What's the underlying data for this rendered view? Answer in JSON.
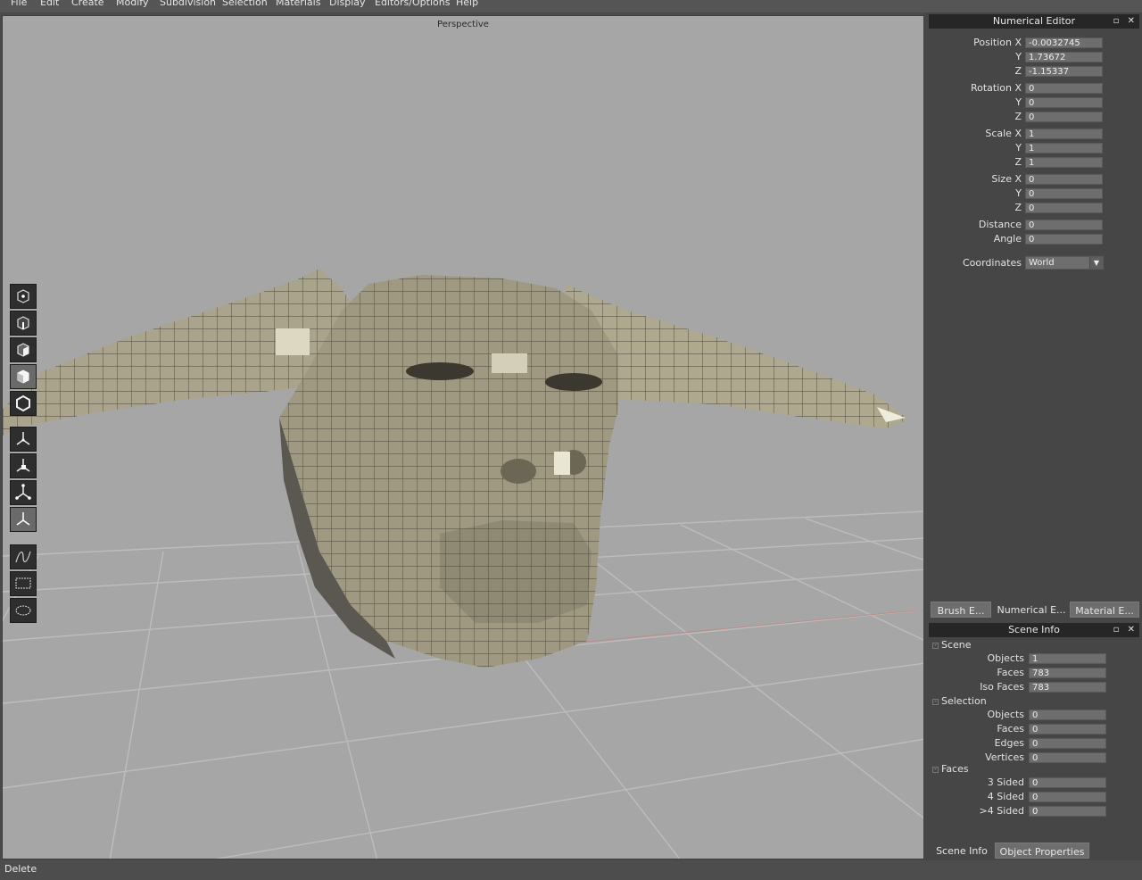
{
  "menu": [
    "File",
    "Edit",
    "Create",
    "Modify",
    "Subdivision",
    "Selection",
    "Materials",
    "Display",
    "Editors/Options",
    "Help"
  ],
  "viewport": {
    "label": "Perspective"
  },
  "numerical_editor": {
    "title": "Numerical Editor",
    "position": {
      "x_label": "Position X",
      "y_label": "Y",
      "z_label": "Z",
      "x": "-0.0032745",
      "y": "1.73672",
      "z": "-1.15337"
    },
    "rotation": {
      "x_label": "Rotation X",
      "y_label": "Y",
      "z_label": "Z",
      "x": "0",
      "y": "0",
      "z": "0"
    },
    "scale": {
      "x_label": "Scale X",
      "y_label": "Y",
      "z_label": "Z",
      "x": "1",
      "y": "1",
      "z": "1"
    },
    "size": {
      "x_label": "Size X",
      "y_label": "Y",
      "z_label": "Z",
      "x": "0",
      "y": "0",
      "z": "0"
    },
    "distance": {
      "label": "Distance",
      "value": "0"
    },
    "angle": {
      "label": "Angle",
      "value": "0"
    },
    "coordinates": {
      "label": "Coordinates",
      "value": "World"
    }
  },
  "editor_tabs": [
    "Brush E...",
    "Numerical E...",
    "Material E..."
  ],
  "scene_info": {
    "title": "Scene Info",
    "scene": {
      "label": "Scene",
      "objects_label": "Objects",
      "objects": "1",
      "faces_label": "Faces",
      "faces": "783",
      "iso_faces_label": "Iso Faces",
      "iso_faces": "783"
    },
    "selection": {
      "label": "Selection",
      "objects_label": "Objects",
      "objects": "0",
      "faces_label": "Faces",
      "faces": "0",
      "edges_label": "Edges",
      "edges": "0",
      "vertices_label": "Vertices",
      "vertices": "0"
    },
    "faces": {
      "label": "Faces",
      "three_label": "3 Sided",
      "three": "0",
      "four_label": "4 Sided",
      "four": "0",
      "more_label": ">4 Sided",
      "more": "0"
    }
  },
  "bottom_tabs": [
    "Scene Info",
    "Object Properties"
  ],
  "status": "Delete",
  "title_buttons": "▫ ✕",
  "colors": {
    "viewport_bg": "#a6a6a6",
    "panel_bg": "#464646",
    "title_bar": "#262626",
    "mesh": "#a8a28a"
  }
}
